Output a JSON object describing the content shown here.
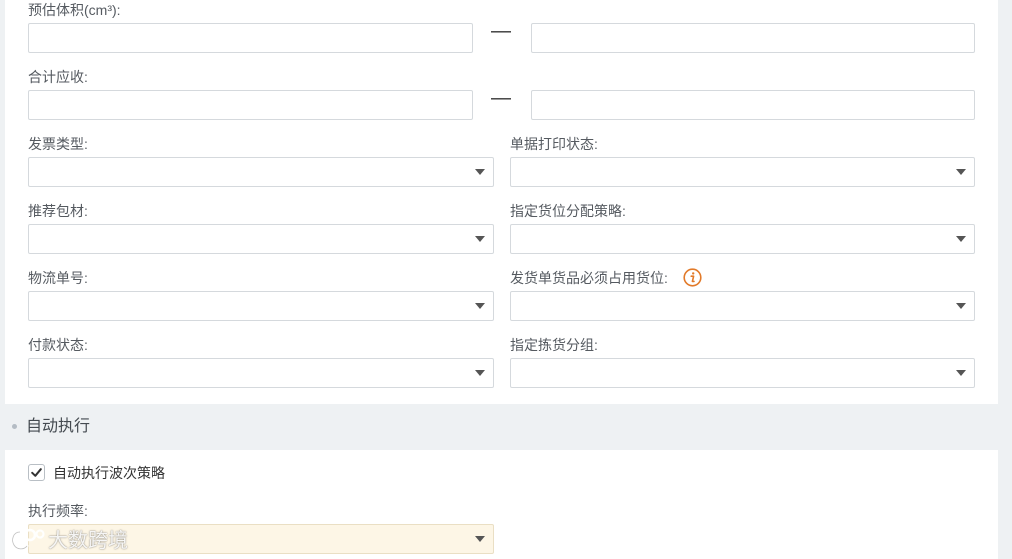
{
  "form": {
    "volume": {
      "label": "预估体积(cm³):",
      "min_value": "",
      "max_value": "",
      "separator": "—"
    },
    "total_receivable": {
      "label": "合计应收:",
      "min_value": "",
      "max_value": "",
      "separator": "—"
    },
    "invoice_type": {
      "label": "发票类型:",
      "value": ""
    },
    "document_print_status": {
      "label": "单据打印状态:",
      "value": ""
    },
    "recommended_packaging": {
      "label": "推荐包材:",
      "value": ""
    },
    "location_allocation_strategy": {
      "label": "指定货位分配策略:",
      "value": ""
    },
    "tracking_number": {
      "label": "物流单号:",
      "value": ""
    },
    "must_occupy_location": {
      "label": "发货单货品必须占用货位:",
      "value": ""
    },
    "payment_status": {
      "label": "付款状态:",
      "value": ""
    },
    "picking_group": {
      "label": "指定拣货分组:",
      "value": ""
    }
  },
  "auto_execute": {
    "section_title": "自动执行",
    "checkbox_label": "自动执行波次策略",
    "checked": true,
    "frequency": {
      "label": "执行频率:",
      "value": ""
    }
  },
  "watermark": {
    "text": "大数跨境"
  },
  "icons": {
    "dropdown": "caret-down-icon",
    "info": "info-icon",
    "checkbox": "checkmark-icon",
    "watermark": "watermark-logo-icon"
  },
  "colors": {
    "page_background": "#eef1f3",
    "panel_background": "#ffffff",
    "info_icon": "#e27a2a",
    "highlight_field_background": "#fdf6e6",
    "section_dot": "#b4bcc4"
  }
}
